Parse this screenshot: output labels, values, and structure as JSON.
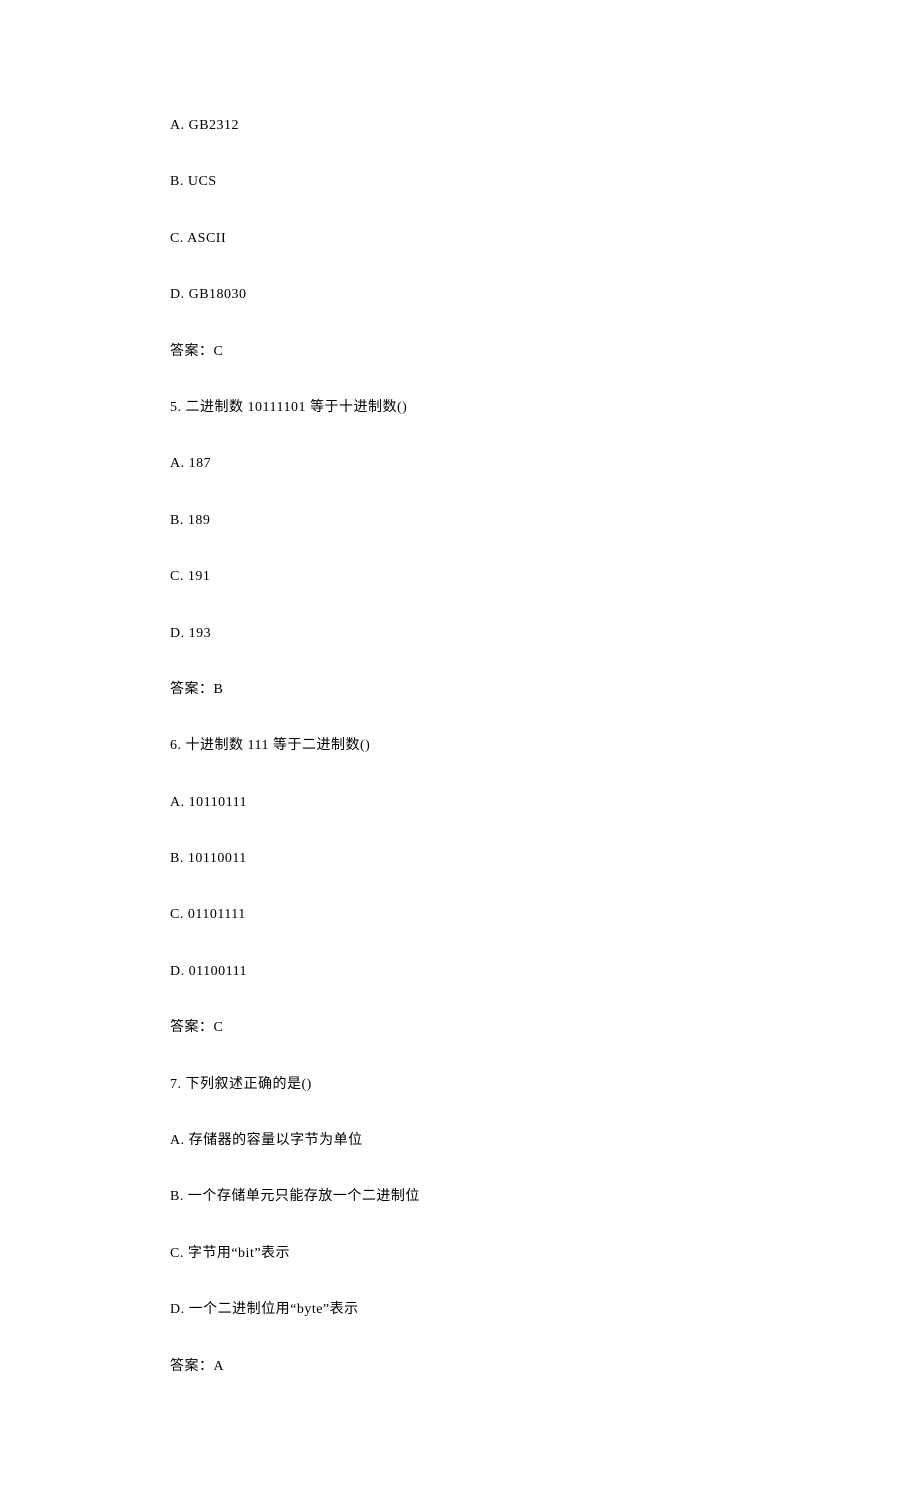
{
  "q4": {
    "optA": "A. GB2312",
    "optB": "B. UCS",
    "optC": "C. ASCII",
    "optD": "D. GB18030",
    "answer": "答案：C"
  },
  "q5": {
    "stem": "5. 二进制数 10111101 等于十进制数()",
    "optA": "A. 187",
    "optB": "B. 189",
    "optC": "C. 191",
    "optD": "D. 193",
    "answer": "答案：B"
  },
  "q6": {
    "stem": "6. 十进制数 111 等于二进制数()",
    "optA": "A. 10110111",
    "optB": "B. 10110011",
    "optC": "C. 01101111",
    "optD": "D. 01100111",
    "answer": "答案：C"
  },
  "q7": {
    "stem": "7. 下列叙述正确的是()",
    "optA": "A. 存储器的容量以字节为单位",
    "optB": "B. 一个存储单元只能存放一个二进制位",
    "optC": "C. 字节用“bit”表示",
    "optD": "D. 一个二进制位用“byte”表示",
    "answer": "答案：A"
  }
}
